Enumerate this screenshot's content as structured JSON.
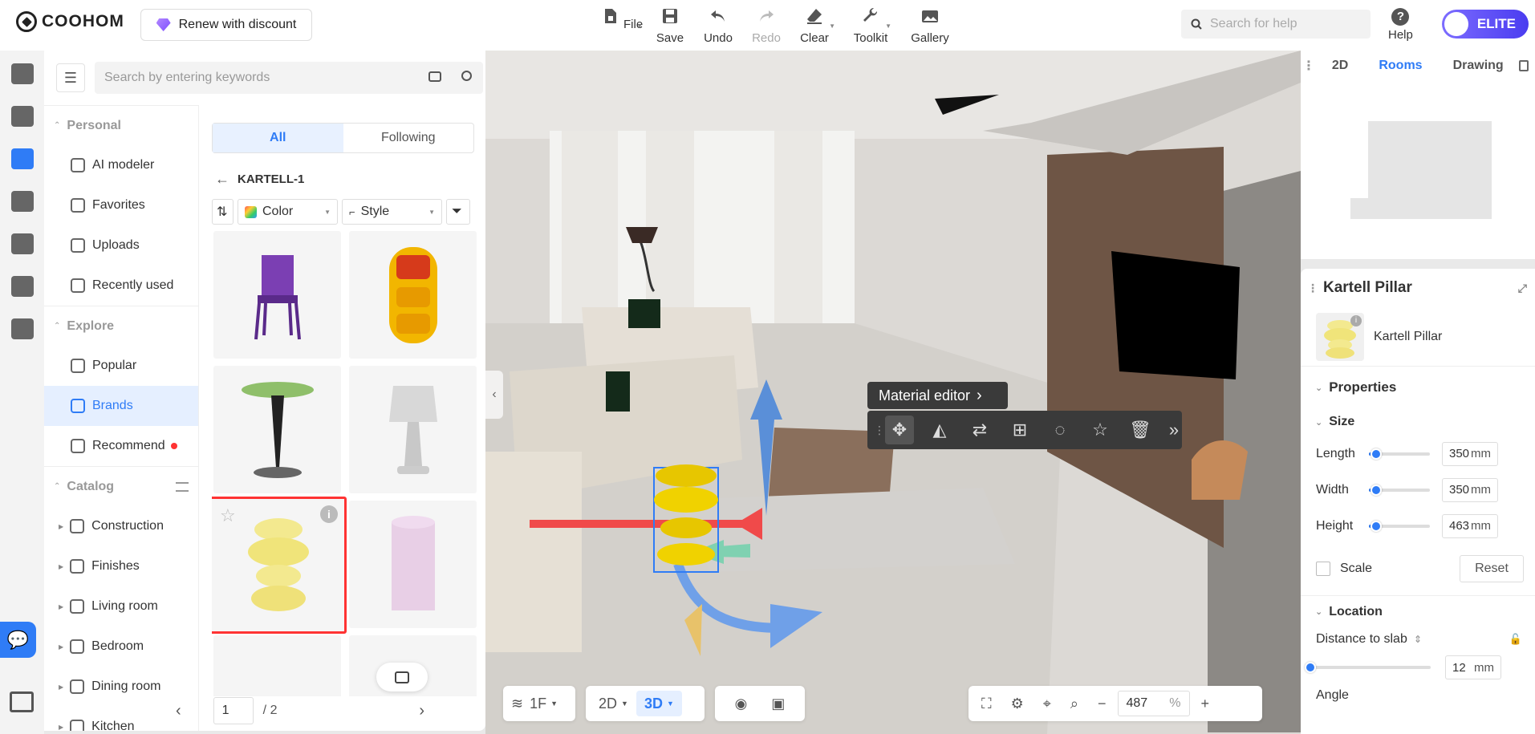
{
  "brand": {
    "logo_text": "COOHOM"
  },
  "topbar": {
    "renew_label": "Renew with discount",
    "tools": [
      {
        "label": "File",
        "icon": "file-icon"
      },
      {
        "label": "Save",
        "icon": "save-icon"
      },
      {
        "label": "Undo",
        "icon": "undo-icon"
      },
      {
        "label": "Redo",
        "icon": "redo-icon"
      },
      {
        "label": "Clear",
        "icon": "eraser-icon"
      },
      {
        "label": "Toolkit",
        "icon": "wrench-icon"
      },
      {
        "label": "Gallery",
        "icon": "gallery-icon"
      }
    ],
    "search_placeholder": "Search for help",
    "help_label": "Help",
    "elite_label": "ELITE"
  },
  "left_panel": {
    "search_placeholder": "Search by entering keywords",
    "nav": {
      "personal_title": "Personal",
      "personal_items": [
        "AI modeler",
        "Favorites",
        "Uploads",
        "Recently used"
      ],
      "explore_title": "Explore",
      "explore_items": [
        "Popular",
        "Brands",
        "Recommend"
      ],
      "catalog_title": "Catalog",
      "catalog_items": [
        "Construction",
        "Finishes",
        "Living room",
        "Bedroom",
        "Dining room",
        "Kitchen"
      ]
    },
    "tabs": [
      "All",
      "Following"
    ],
    "breadcrumb": "KARTELL-1",
    "filters": {
      "color": "Color",
      "style": "Style"
    },
    "pager": {
      "current": "1",
      "total": "/ 2"
    }
  },
  "viewport": {
    "material_tip": "Material editor",
    "floor": "1F",
    "view_2d": "2D",
    "view_3d": "3D",
    "zoom_value": "487",
    "zoom_unit": "%"
  },
  "minimap": {
    "tabs": [
      "2D",
      "Rooms",
      "Drawing"
    ]
  },
  "properties": {
    "title": "Kartell Pillar",
    "product_name": "Kartell Pillar",
    "section_properties": "Properties",
    "section_size": "Size",
    "size": [
      {
        "label": "Length",
        "value": "350",
        "unit": "mm",
        "fraction": 0.12
      },
      {
        "label": "Width",
        "value": "350",
        "unit": "mm",
        "fraction": 0.12
      },
      {
        "label": "Height",
        "value": "463",
        "unit": "mm",
        "fraction": 0.12
      }
    ],
    "scale_label": "Scale",
    "reset_label": "Reset",
    "section_location": "Location",
    "distance_label": "Distance to slab",
    "distance_value": "12",
    "distance_unit": "mm",
    "angle_label": "Angle"
  },
  "colors": {
    "accent": "#2f7cf6",
    "selection": "#ff3333",
    "elite": "#5b4cf5"
  }
}
